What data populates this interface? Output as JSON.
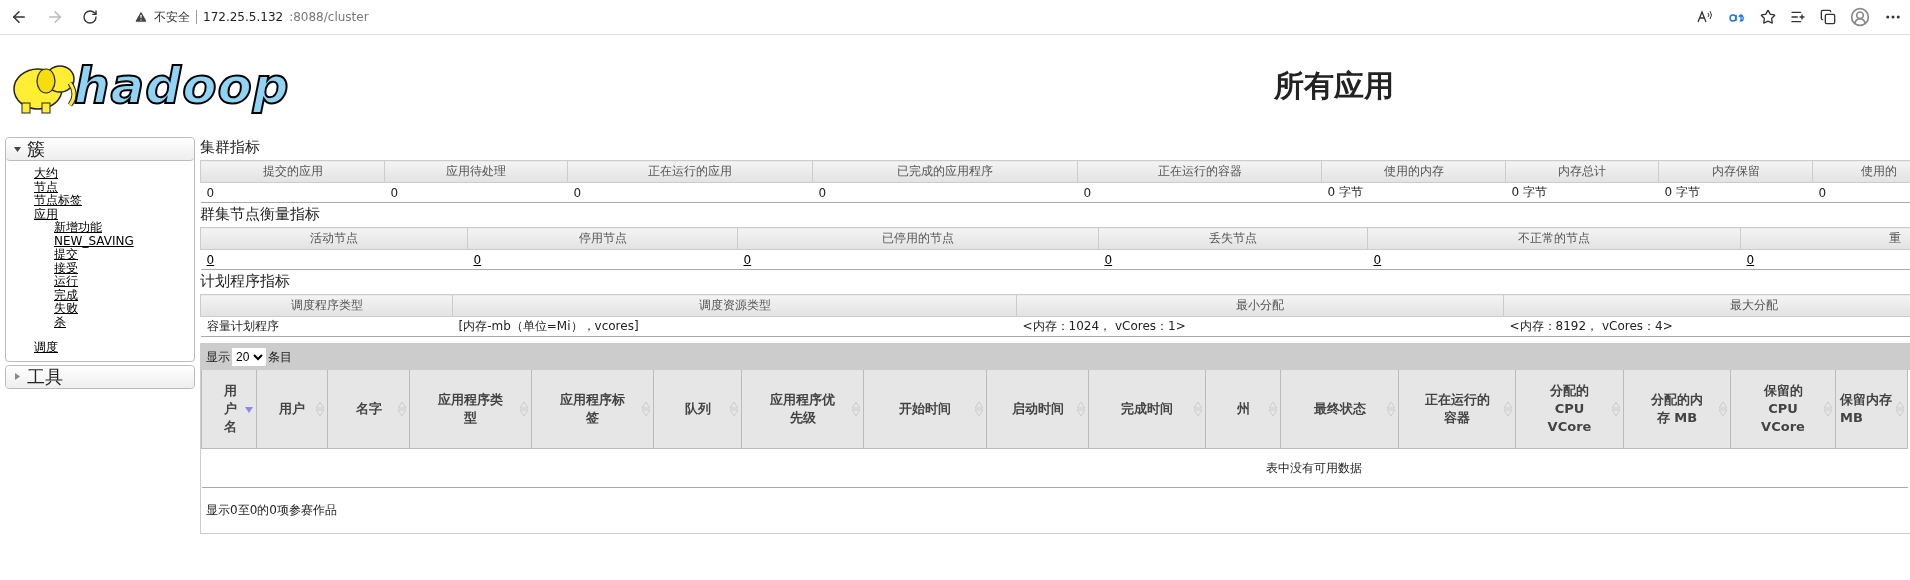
{
  "browser": {
    "security_label": "不安全",
    "url_host": "172.25.5.132",
    "url_path": ":8088/cluster",
    "back_disabled": false,
    "forward_disabled": true
  },
  "logo_text": "hadoop",
  "page_title": "所有应用",
  "sidebar": {
    "sections": [
      {
        "title": "簇",
        "expanded": true,
        "items": [
          {
            "label": "大约"
          },
          {
            "label": "节点"
          },
          {
            "label": "节点标签"
          },
          {
            "label": "应用",
            "children": [
              {
                "label": "新增功能"
              },
              {
                "label": "NEW_SAVING"
              },
              {
                "label": "提交"
              },
              {
                "label": "接受"
              },
              {
                "label": "运行"
              },
              {
                "label": "完成"
              },
              {
                "label": "失败"
              },
              {
                "label": "杀"
              }
            ]
          },
          {
            "label": "调度"
          }
        ]
      },
      {
        "title": "工具",
        "expanded": false
      }
    ]
  },
  "cluster_metrics": {
    "title": "集群指标",
    "columns": [
      "提交的应用",
      "应用待处理",
      "正在运行的应用",
      "已完成的应用程序",
      "正在运行的容器",
      "使用的内存",
      "内存总计",
      "内存保留",
      "使用的"
    ],
    "values": [
      "0",
      "0",
      "0",
      "0",
      "0",
      "0 字节",
      "0 字节",
      "0 字节",
      "0"
    ]
  },
  "node_metrics": {
    "title": "群集节点衡量指标",
    "columns": [
      "活动节点",
      "停用节点",
      "已停用的节点",
      "丢失节点",
      "不正常的节点",
      "重"
    ],
    "values": [
      "0",
      "0",
      "0",
      "0",
      "0",
      "0"
    ]
  },
  "scheduler_metrics": {
    "title": "计划程序指标",
    "columns": [
      "调度程序类型",
      "调度资源类型",
      "最小分配",
      "最大分配"
    ],
    "values": [
      "容量计划程序",
      "[内存-mb（单位=Mi），vcores]",
      "<内存：1024， vCores：1>",
      "<内存：8192， vCores：4>"
    ]
  },
  "apps_table": {
    "show_label": "显示",
    "page_size": "20",
    "entries_label": "条目",
    "columns": [
      {
        "label": "用户名",
        "sorted": true
      },
      {
        "label": "用户",
        "sorted": false
      },
      {
        "label": "名字",
        "sorted": false
      },
      {
        "label": "应用程序类型",
        "sorted": false
      },
      {
        "label": "应用程序标签",
        "sorted": false
      },
      {
        "label": "队列",
        "sorted": false
      },
      {
        "label": "应用程序优先级",
        "sorted": false
      },
      {
        "label": "开始时间",
        "sorted": false
      },
      {
        "label": "启动时间",
        "sorted": false
      },
      {
        "label": "完成时间",
        "sorted": false
      },
      {
        "label": "州",
        "sorted": false
      },
      {
        "label": "最终状态",
        "sorted": false
      },
      {
        "label": "正在运行的容器",
        "sorted": false
      },
      {
        "label": "分配的 CPU VCore",
        "sorted": false
      },
      {
        "label": "分配的内存 MB",
        "sorted": false
      },
      {
        "label": "保留的 CPU VCore",
        "sorted": false
      },
      {
        "label": "保留内存 MB",
        "sorted": false
      }
    ],
    "empty_message": "表中没有可用数据",
    "info": "显示0至0的0项参赛作品"
  }
}
